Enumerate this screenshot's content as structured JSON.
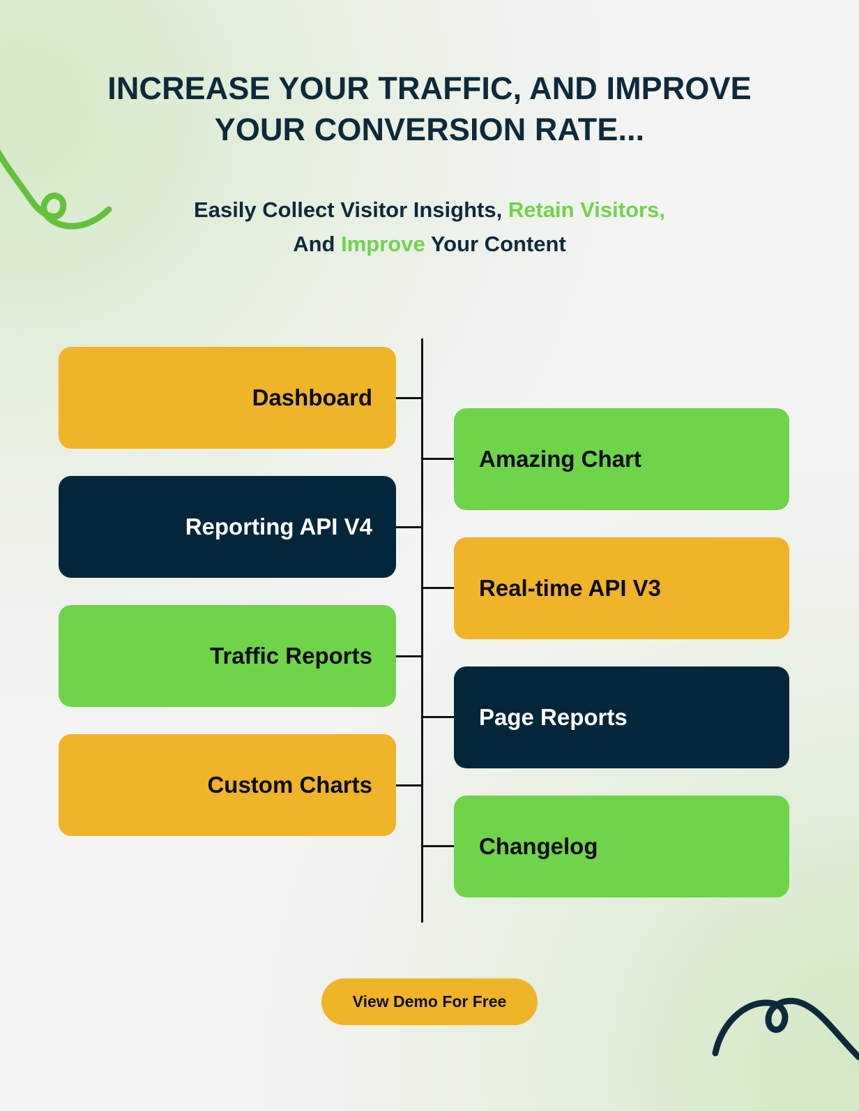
{
  "header": {
    "headline": "INCREASE YOUR TRAFFIC, AND IMPROVE YOUR CONVERSION RATE...",
    "subtitle_part1": "Easily Collect Visitor Insights, ",
    "subtitle_accent1": "Retain Visitors,",
    "subtitle_part2": "And ",
    "subtitle_accent2": "Improve",
    "subtitle_part3": " Your Content"
  },
  "diagram": {
    "left_nodes": [
      {
        "label": "Dashboard",
        "color": "amber"
      },
      {
        "label": "Reporting API V4",
        "color": "navy"
      },
      {
        "label": "Traffic Reports",
        "color": "green"
      },
      {
        "label": "Custom Charts",
        "color": "amber"
      }
    ],
    "right_nodes": [
      {
        "label": "Amazing Chart",
        "color": "green"
      },
      {
        "label": "Real-time API V3",
        "color": "amber"
      },
      {
        "label": "Page Reports",
        "color": "navy"
      },
      {
        "label": "Changelog",
        "color": "green"
      }
    ]
  },
  "cta": {
    "label": "View Demo For Free"
  },
  "decor": {
    "swirl_top_left": "green-swirl-icon",
    "swirl_bottom_right": "navy-swirl-icon"
  },
  "colors": {
    "amber": "#f0b428",
    "green": "#6fd44a",
    "navy": "#04263a",
    "background": "#f4f4f4",
    "line": "#111111"
  }
}
